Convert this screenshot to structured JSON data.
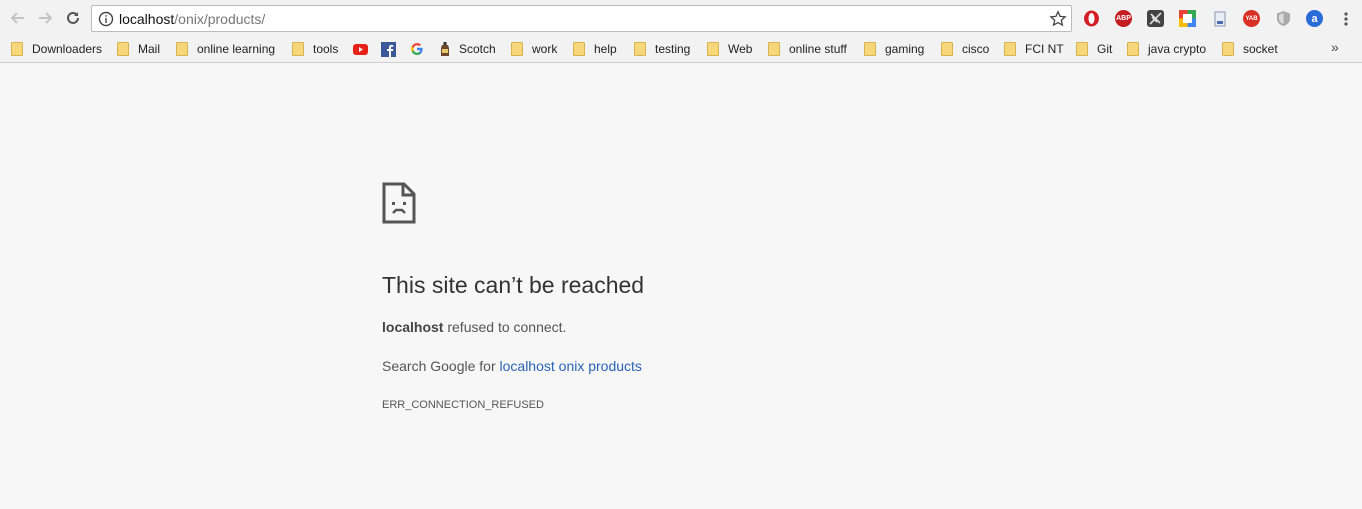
{
  "address_bar": {
    "url_host": "localhost",
    "url_path": "/onix/products/"
  },
  "bookmarks": [
    {
      "label": "Downloaders",
      "kind": "folder"
    },
    {
      "label": "Mail",
      "kind": "folder"
    },
    {
      "label": "online learning",
      "kind": "folder"
    },
    {
      "label": "tools",
      "kind": "folder"
    },
    {
      "label": "",
      "kind": "youtube-icon"
    },
    {
      "label": "",
      "kind": "facebook-icon"
    },
    {
      "label": "",
      "kind": "google-icon"
    },
    {
      "label": "Scotch",
      "kind": "scotch-icon"
    },
    {
      "label": "work",
      "kind": "folder"
    },
    {
      "label": "help",
      "kind": "folder"
    },
    {
      "label": "testing",
      "kind": "folder"
    },
    {
      "label": "Web",
      "kind": "folder"
    },
    {
      "label": "online stuff",
      "kind": "folder"
    },
    {
      "label": "gaming",
      "kind": "folder"
    },
    {
      "label": "cisco",
      "kind": "folder"
    },
    {
      "label": "FCI NT",
      "kind": "folder"
    },
    {
      "label": "Git",
      "kind": "folder"
    },
    {
      "label": "java crypto",
      "kind": "folder"
    },
    {
      "label": "socket",
      "kind": "folder"
    }
  ],
  "bookmarks_more": "»",
  "extensions": {
    "abp_label": "ABP",
    "yab_label": "YAB",
    "a_label": "a"
  },
  "error": {
    "title": "This site can’t be reached",
    "host": "localhost",
    "message": " refused to connect.",
    "suggest_prefix": "Search Google for ",
    "suggest_link": "localhost onix products",
    "code": "ERR_CONNECTION_REFUSED"
  },
  "colors": {
    "link": "#2a63b7",
    "page_bg": "#f7f7f7",
    "folder": "#f7d77b"
  }
}
